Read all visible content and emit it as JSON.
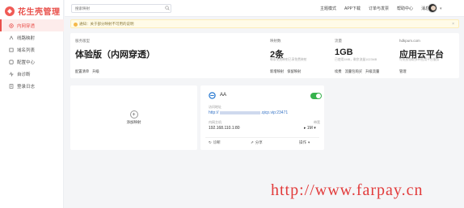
{
  "app": {
    "logo_text": "花生壳管理"
  },
  "sidebar": {
    "items": [
      {
        "label": "内网穿透",
        "active": true,
        "icon": "network-icon"
      },
      {
        "label": "线路映射",
        "icon": "route-icon"
      },
      {
        "label": "域名列表",
        "icon": "domain-icon"
      },
      {
        "label": "配置中心",
        "icon": "settings-icon"
      },
      {
        "label": "自诊断",
        "icon": "diagnose-icon"
      },
      {
        "label": "登录日志",
        "icon": "log-icon"
      }
    ]
  },
  "topbar": {
    "search_placeholder": "搜索映射",
    "links": [
      "主题模式",
      "APP下载",
      "订单与发票",
      "帮助中心",
      "消息"
    ]
  },
  "notice": {
    "text": "通知：关于部分映射不可用的说明"
  },
  "overview": {
    "version": {
      "label": "服务版型",
      "value": "体验版（内网穿透）",
      "links": [
        "配置清单",
        "升级"
      ]
    },
    "mappings": {
      "label": "映射数",
      "value": "2条",
      "desc": "每条免费映射已享免费映射",
      "links": [
        "新增映射",
        "保留映射"
      ]
    },
    "traffic": {
      "label": "流量",
      "value": "1GB",
      "desc": "已使用1MB，剩余流量1023MB",
      "links": [
        "续费",
        "流量包购买",
        "升级流量"
      ]
    },
    "platform": {
      "label": "hdkpum.com",
      "value": "应用云平台",
      "desc": "可免费领取多种应用平台服务",
      "links": [
        "管理"
      ]
    }
  },
  "add_card": {
    "label": "添加映射"
  },
  "mapping": {
    "name": "AA",
    "enabled": true,
    "access_label": "访问地址",
    "url_prefix": "http://",
    "url_suffix": ".qicp.vip:23471",
    "host_label": "内网主机",
    "host": "192.168.110.1:80",
    "bandwidth_label": "带宽",
    "bandwidth": "1M",
    "actions": [
      "诊断",
      "分享",
      "操作"
    ]
  },
  "watermark": "http://www.farpay.cn",
  "colors": {
    "brand": "#e9504b",
    "toggle_on": "#37b24d",
    "link": "#3975c6"
  }
}
